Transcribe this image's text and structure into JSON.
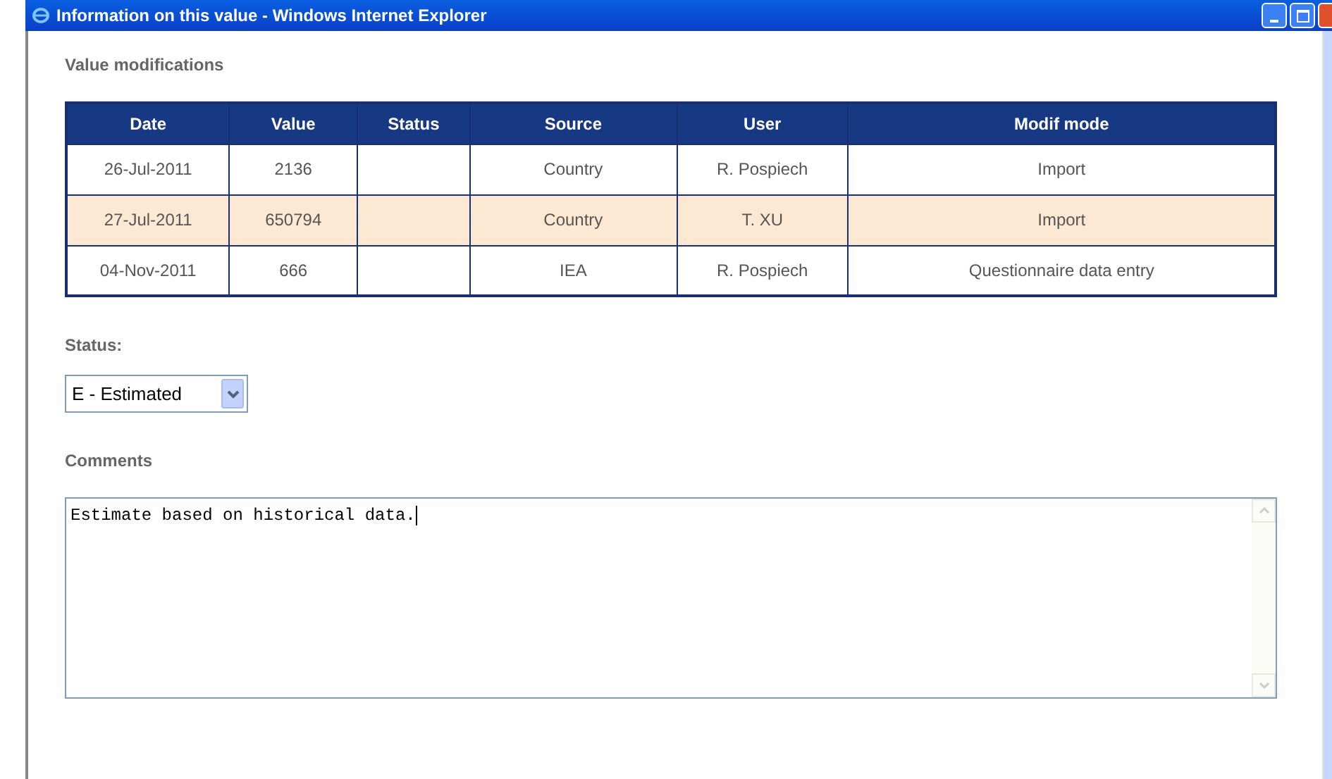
{
  "window": {
    "title": "Information on this value - Windows Internet Explorer"
  },
  "section_title": "Value modifications",
  "table": {
    "columns": [
      "Date",
      "Value",
      "Status",
      "Source",
      "User",
      "Modif mode"
    ],
    "rows": [
      {
        "cells": [
          "26-Jul-2011",
          "2136",
          "",
          "Country",
          "R. Pospiech",
          "Import"
        ],
        "selected": false
      },
      {
        "cells": [
          "27-Jul-2011",
          "650794",
          "",
          "Country",
          "T. XU",
          "Import"
        ],
        "selected": true
      },
      {
        "cells": [
          "04-Nov-2011",
          "666",
          "",
          "IEA",
          "R. Pospiech",
          "Questionnaire data entry"
        ],
        "selected": false
      }
    ]
  },
  "status": {
    "label": "Status:",
    "value": "E - Estimated"
  },
  "comments": {
    "label": "Comments",
    "value": "Estimate based on historical data."
  }
}
